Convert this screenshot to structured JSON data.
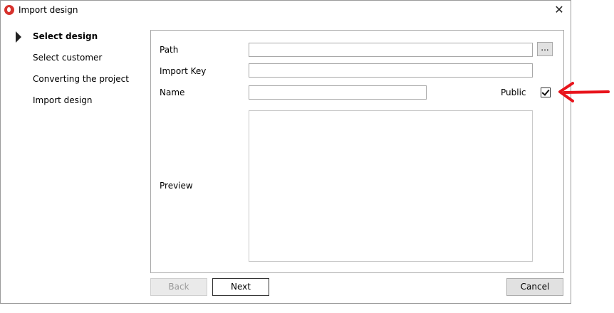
{
  "window": {
    "title": "Import design"
  },
  "steps": [
    {
      "label": "Select design",
      "active": true
    },
    {
      "label": "Select customer",
      "active": false
    },
    {
      "label": "Converting the project",
      "active": false
    },
    {
      "label": "Import design",
      "active": false
    }
  ],
  "form": {
    "path_label": "Path",
    "path_value": "",
    "browse_label": "...",
    "import_key_label": "Import Key",
    "import_key_value": "",
    "name_label": "Name",
    "name_value": "",
    "public_label": "Public",
    "public_checked": true,
    "preview_label": "Preview"
  },
  "buttons": {
    "back": "Back",
    "next": "Next",
    "cancel": "Cancel"
  },
  "colors": {
    "annotation_arrow": "#e8141c",
    "app_icon": "#d7322d"
  }
}
